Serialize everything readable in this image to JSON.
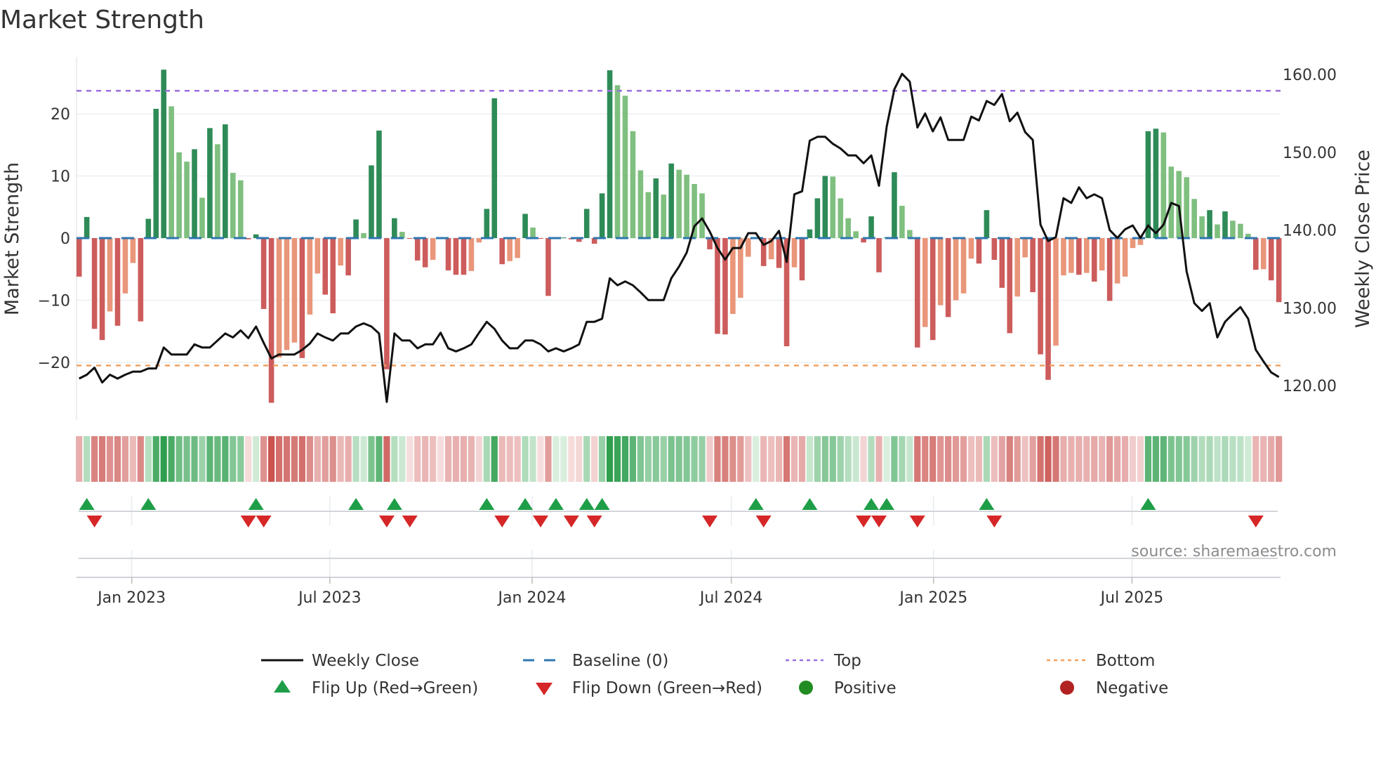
{
  "chart_data": {
    "type": "bar",
    "title": "Market Strength",
    "ylabel": "Market Strength",
    "y2label": "Weekly Close Price",
    "ylim": [
      -29.3,
      29.3
    ],
    "y2lim": [
      115.6,
      162.3
    ],
    "yticks": [
      20,
      10,
      0,
      -10,
      -20
    ],
    "ytick_labels": [
      "20",
      "10",
      "0",
      "−10",
      "−20"
    ],
    "y2ticks": [
      160,
      150,
      140,
      130,
      120
    ],
    "y2tick_labels": [
      "160.00",
      "150.00",
      "140.00",
      "130.00",
      "120.00"
    ],
    "x_unit": "week index",
    "xticks": [
      6.84,
      32.6,
      58.9,
      84.8,
      111.1,
      136.9
    ],
    "xtick_labels": [
      "Jan 2023",
      "Jul 2023",
      "Jan 2024",
      "Jul 2024",
      "Jan 2025",
      "Jul 2025"
    ],
    "top_level": 23.7,
    "bottom_level": -20.5,
    "baseline": 0,
    "grid": true,
    "legend_placement": "bottom",
    "series": [
      {
        "name": "Market Strength",
        "type": "bar",
        "values": [
          -6.2,
          3.4,
          -14.6,
          -16.4,
          -11.8,
          -14.1,
          -8.9,
          -4.0,
          -13.4,
          3.1,
          20.8,
          27.1,
          21.2,
          13.8,
          12.3,
          14.3,
          6.5,
          17.7,
          15.1,
          18.3,
          10.5,
          9.3,
          -0.2,
          0.6,
          -11.4,
          -26.5,
          -19.2,
          -18.0,
          -16.8,
          -19.3,
          -12.3,
          -5.7,
          -9.1,
          -12.1,
          -4.4,
          -6.0,
          3.0,
          0.8,
          11.7,
          17.3,
          -21.1,
          3.2,
          1.0,
          -0.1,
          -3.6,
          -4.7,
          -3.5,
          -0.1,
          -5.2,
          -5.9,
          -5.9,
          -5.3,
          -0.7,
          4.7,
          22.5,
          -4.2,
          -3.7,
          -3.2,
          3.9,
          1.7,
          -0.1,
          -9.3,
          0.1,
          0.1,
          -0.2,
          -0.6,
          4.7,
          -0.9,
          7.2,
          27.0,
          24.6,
          22.9,
          17.2,
          10.9,
          7.4,
          9.6,
          7.0,
          12.0,
          11.0,
          10.2,
          8.7,
          7.2,
          -1.8,
          -15.4,
          -15.5,
          -12.2,
          -9.6,
          -3.0,
          0.1,
          -4.5,
          -3.4,
          -4.8,
          -17.4,
          -4.7,
          -6.8,
          1.4,
          6.4,
          10.0,
          9.9,
          6.4,
          3.2,
          1.1,
          -0.7,
          3.5,
          -5.5,
          0.1,
          10.6,
          5.2,
          1.3,
          -17.6,
          -14.3,
          -16.4,
          -10.8,
          -12.7,
          -10.0,
          -8.9,
          -3.3,
          -4.1,
          4.5,
          -3.5,
          -8.0,
          -15.3,
          -9.4,
          -3.1,
          -8.7,
          -18.7,
          -22.8,
          -17.3,
          -6.0,
          -5.6,
          -5.9,
          -5.6,
          -7.0,
          -5.2,
          -10.1,
          -7.3,
          -6.2,
          -1.6,
          -1.1,
          17.2,
          17.6,
          17.0,
          11.5,
          10.8,
          9.8,
          6.3,
          3.5,
          4.5,
          2.2,
          4.3,
          2.8,
          2.3,
          0.7,
          -5.1,
          -5.0,
          -6.8,
          -10.3
        ]
      },
      {
        "name": "Weekly Close",
        "type": "line",
        "axis": "right",
        "values": [
          120.9,
          121.4,
          122.3,
          120.4,
          121.4,
          120.9,
          121.4,
          121.8,
          121.8,
          122.2,
          122.2,
          124.9,
          124.0,
          124.0,
          124.0,
          125.3,
          124.9,
          124.9,
          125.8,
          126.7,
          126.2,
          127.1,
          126.1,
          127.6,
          125.5,
          123.5,
          124.0,
          124.0,
          124.0,
          124.6,
          125.4,
          126.7,
          126.2,
          125.8,
          126.7,
          126.7,
          127.6,
          128.0,
          127.6,
          126.7,
          117.9,
          126.7,
          125.8,
          125.8,
          124.8,
          125.3,
          125.3,
          126.8,
          124.8,
          124.4,
          124.8,
          125.3,
          126.8,
          128.2,
          127.3,
          125.8,
          124.8,
          124.8,
          125.8,
          125.8,
          125.3,
          124.4,
          124.8,
          124.4,
          124.8,
          125.3,
          128.2,
          128.2,
          128.6,
          133.8,
          132.9,
          133.4,
          132.9,
          132.0,
          131.0,
          131.0,
          131.0,
          133.8,
          135.3,
          137.1,
          140.5,
          141.5,
          139.8,
          137.7,
          136.2,
          137.7,
          137.7,
          139.6,
          139.6,
          138.1,
          138.6,
          139.9,
          135.9,
          144.6,
          145.0,
          151.5,
          152.0,
          152.0,
          151.1,
          150.5,
          149.6,
          149.6,
          148.6,
          149.6,
          145.7,
          153.3,
          158.1,
          160.1,
          159.1,
          153.2,
          155.0,
          152.7,
          154.5,
          151.6,
          151.6,
          151.6,
          154.6,
          154.1,
          156.6,
          156.1,
          157.5,
          154.0,
          155.1,
          152.6,
          151.6,
          140.7,
          138.6,
          139.1,
          144.1,
          143.5,
          145.5,
          144.1,
          144.6,
          144.1,
          140.0,
          139.0,
          140.1,
          140.6,
          139.0,
          140.6,
          139.6,
          140.7,
          143.5,
          143.1,
          134.7,
          130.6,
          129.6,
          130.6,
          126.2,
          128.2,
          129.2,
          130.1,
          128.6,
          124.6,
          123.1,
          121.7,
          121.1
        ]
      }
    ],
    "legend": [
      {
        "label": "Weekly Close",
        "marker": "line",
        "color": "#111111"
      },
      {
        "label": "Baseline (0)",
        "marker": "dashed",
        "color": "#2f77b0"
      },
      {
        "label": "Top",
        "marker": "dotted",
        "color": "#9b6fe0"
      },
      {
        "label": "Bottom",
        "marker": "dotted",
        "color": "#f0a060"
      },
      {
        "label": "Flip Up (Red→Green)",
        "marker": "triangle-up",
        "color": "#1f9e48"
      },
      {
        "label": "Flip Down (Green→Red)",
        "marker": "triangle-down",
        "color": "#d62728"
      },
      {
        "label": "Positive",
        "marker": "circle",
        "color": "#228b22"
      },
      {
        "label": "Negative",
        "marker": "circle",
        "color": "#b22222"
      }
    ],
    "source": "source: sharemaestro.com",
    "colors": {
      "pos_strong": "#2e8b57",
      "pos_weak": "#7fbf7f",
      "neg_strong": "#cd5c5c",
      "neg_weak": "#e9967a",
      "flip_up": "#1f9e48",
      "flip_down": "#d62728"
    }
  }
}
